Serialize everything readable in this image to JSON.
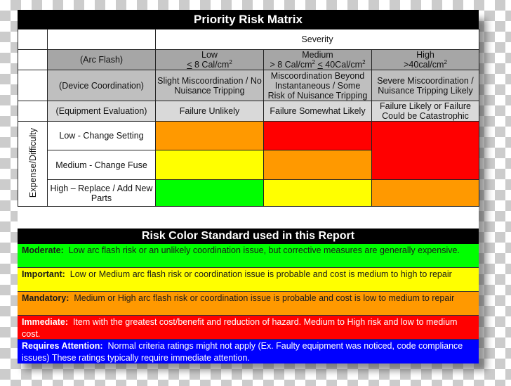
{
  "matrix": {
    "title": "Priority Risk Matrix",
    "severity_label": "Severity",
    "row_headers": {
      "arc_flash": "(Arc Flash)",
      "device_coordination": "(Device Coordination)",
      "equipment_evaluation": "(Equipment Evaluation)"
    },
    "columns": [
      {
        "level": "Low",
        "arc_flash_pre": "",
        "arc_flash_main": "< 8 Cal/cm",
        "arc_flash_rest": "",
        "device_coordination": "Slight Miscoordination / No Nuisance Tripping",
        "equipment_evaluation": "Failure Unlikely"
      },
      {
        "level": "Medium",
        "arc_flash_main": "> 8 Cal/cm",
        "arc_flash_rest": "< 40Cal/cm",
        "device_coordination": "Miscoordination Beyond Instantaneous / Some Risk of Nuisance Tripping",
        "equipment_evaluation": "Failure Somewhat Likely"
      },
      {
        "level": "High",
        "arc_flash_main": ">40cal/cm",
        "arc_flash_rest": "",
        "device_coordination": "Severe Miscoordination / Nuisance Tripping Likely",
        "equipment_evaluation": "Failure Likely or Failure Could be Catastrophic"
      }
    ],
    "superscript": "2",
    "side_label": "Expense/Difficulty",
    "rows": [
      {
        "label": "Low - Change Setting",
        "colors": [
          "#ff9900",
          "#ff0000",
          "#ff0000"
        ]
      },
      {
        "label": "Medium - Change Fuse",
        "colors": [
          "#ffff00",
          "#ff9900",
          "#ff0000"
        ]
      },
      {
        "label": "High – Replace / Add New Parts",
        "colors": [
          "#00ff00",
          "#ffff00",
          "#ff9900"
        ]
      }
    ]
  },
  "legend": {
    "title": "Risk Color Standard used in this Report",
    "items": [
      {
        "term": "Moderate:",
        "text": "Low arc flash risk or an unlikely coordination issue, but corrective measures are generally expensive.",
        "bg": "#00ff00",
        "fg": "#1a1a1a"
      },
      {
        "term": "Important:",
        "text": "Low or Medium arc flash risk or coordination issue is probable and cost is medium to high to repair",
        "bg": "#ffff00",
        "fg": "#1a1a1a"
      },
      {
        "term": "Mandatory:",
        "text": "Medium or High arc flash risk or coordination issue is probable and cost is low to medium to repair",
        "bg": "#ff9900",
        "fg": "#1a1a1a"
      },
      {
        "term": "Immediate:",
        "text": "Item with the greatest cost/benefit and reduction of hazard. Medium to High risk and low to medium cost.",
        "bg": "#ff0000",
        "fg": "#ffffff"
      },
      {
        "term": "Requires Attention:",
        "text": "Normal criteria ratings might not apply (Ex. Faulty equipment was noticed, code compliance issues) These ratings typically require immediate attention.",
        "bg": "#0000ff",
        "fg": "#ffffff"
      }
    ]
  }
}
